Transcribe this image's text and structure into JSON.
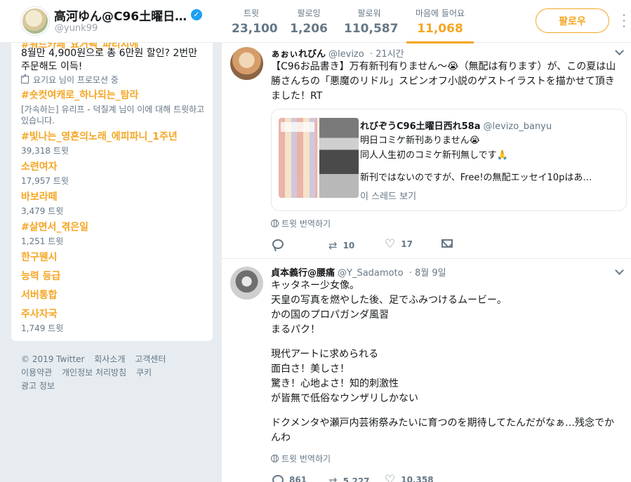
{
  "profile": {
    "name": "高河ゆん@C96土曜日…",
    "handle": "@yunk99",
    "follow_label": "팔로우",
    "stats": [
      {
        "label": "트윗",
        "value": "23,100"
      },
      {
        "label": "팔로잉",
        "value": "1,206"
      },
      {
        "label": "팔로워",
        "value": "110,587"
      },
      {
        "label": "마음에 들어요",
        "value": "11,068"
      }
    ],
    "active_stat": "마음에 들어요",
    "accent_color": "#f5a623"
  },
  "sidebar": {
    "promo": {
      "cut_title": "#워드카페_요거팩_파티시에",
      "text": "8월만 4,900원으로 총 6만원 할인? 2번만 주문해도 이득!",
      "promoted_by": "요기요 님이 프로모션 중"
    },
    "trends": [
      {
        "name": "#숏컷여캐로_하나되는_탐라",
        "desc": "[가속하는] 유리프 - 덕질계 님이 이에 대해 트윗하고 있습니다.",
        "count": ""
      },
      {
        "name": "#빛나는_영혼의노래_에피파니_1주년",
        "desc": "",
        "count": "39,318 트윗"
      },
      {
        "name": "소련여자",
        "desc": "",
        "count": "17,957 트윗"
      },
      {
        "name": "바보라떼",
        "desc": "",
        "count": "3,479 트윗"
      },
      {
        "name": "#살면서_겪은일",
        "desc": "",
        "count": "1,251 트윗"
      },
      {
        "name": "한구웬시",
        "desc": "",
        "count": ""
      },
      {
        "name": "능력 등급",
        "desc": "",
        "count": ""
      },
      {
        "name": "서버통합",
        "desc": "",
        "count": ""
      },
      {
        "name": "주사자국",
        "desc": "",
        "count": "1,749 트윗"
      }
    ],
    "footer": [
      "© 2019 Twitter",
      "회사소개",
      "고객센터",
      "이용약관",
      "개인정보 처리방침",
      "쿠키",
      "광고 정보"
    ]
  },
  "tweets": [
    {
      "name": "ぁぉぃれびん",
      "handle": "@levizo",
      "time": "· 21시간",
      "text": [
        "【C96お品書き】万有新刊有りません〜😭（無配は有ります）が、この夏は山勝さんちの「悪魔のリドル」スピンオフ小説のゲストイラストを描かせて頂きました！RT"
      ],
      "quote": {
        "name": "れびぞうC96土曜日西れ58a",
        "handle": "@levizo_banyu",
        "lines": [
          "明日コミケ新刊ありません😭",
          "同人人生初のコミケ新刊無しです🙏",
          "",
          "新刊ではないのですが、Free!の無配エッセイ10pはあ…"
        ],
        "thread_label": "이 스레드 보기"
      },
      "translate": "트윗 번역하기",
      "replies": "",
      "retweets": "10",
      "likes": "17"
    },
    {
      "name": "貞本義行@腰痛",
      "handle": "@Y_Sadamoto",
      "time": "· 8월 9일",
      "text": [
        "キッタネー少女像。",
        "天皇の写真を燃やした後、足でふみつけるムービー。",
        "かの国のプロパガンダ風習",
        "まるパク！",
        "",
        "現代アートに求められる",
        "面白さ！美しさ！",
        "驚き！心地よさ！知的刺激性",
        "が皆無で低俗なウンザリしかない",
        "",
        "ドクメンタや瀬戸内芸術祭みたいに育つのを期待してたんだがなぁ…残念でかんわ"
      ],
      "translate": "트윗 번역하기",
      "replies": "861",
      "retweets": "5,227",
      "likes": "10,358"
    }
  ]
}
